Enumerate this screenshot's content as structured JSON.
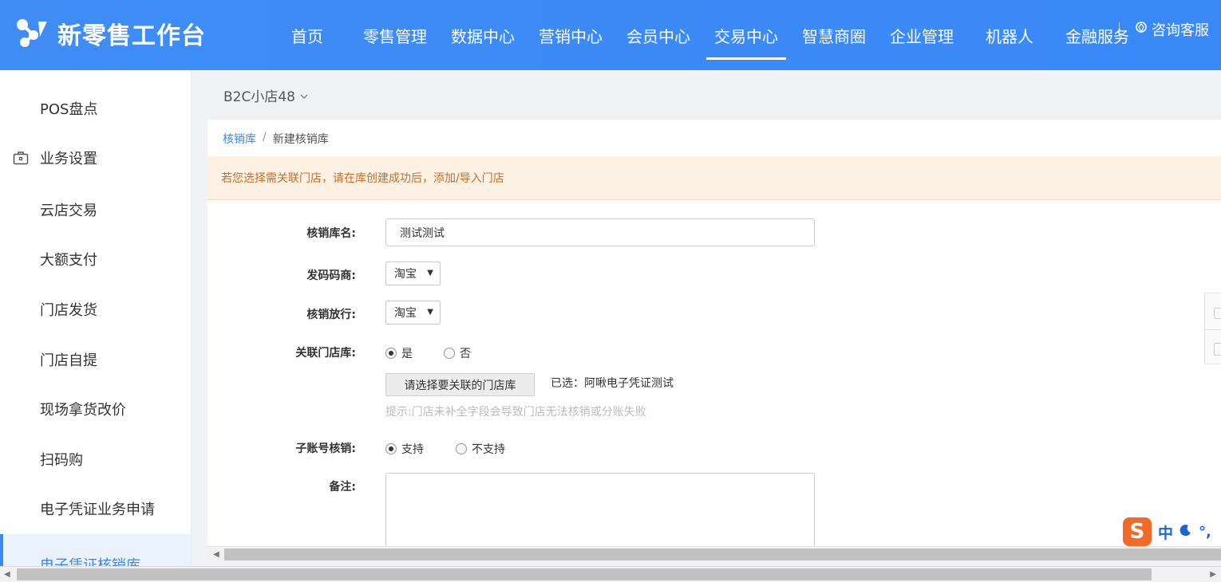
{
  "app": {
    "logo_text": "新零售工作台"
  },
  "nav": {
    "items": [
      "首页",
      "零售管理",
      "数据中心",
      "营销中心",
      "会员中心",
      "交易中心",
      "智慧商圈",
      "企业管理",
      "机器人",
      "金融服务"
    ],
    "active": "交易中心",
    "consult_label": "咨询客服"
  },
  "sidebar": {
    "items": [
      {
        "label": "POS盘点"
      },
      {
        "label": "业务设置",
        "icon": "briefcase-icon"
      },
      {
        "label": "云店交易"
      },
      {
        "label": "大额支付"
      },
      {
        "label": "门店发货"
      },
      {
        "label": "门店自提"
      },
      {
        "label": "现场拿货改价"
      },
      {
        "label": "扫码购"
      },
      {
        "label": "电子凭证业务申请"
      },
      {
        "label": "电子凭证核销库"
      }
    ],
    "active": "电子凭证核销库"
  },
  "store_selector": {
    "value": "B2C小店48"
  },
  "breadcrumb": {
    "parent": "核销库",
    "separator": "/",
    "current": "新建核销库"
  },
  "notice": {
    "text": "若您选择需关联门店，请在库创建成功后，添加/导入门店"
  },
  "form": {
    "name": {
      "label": "核销库名:",
      "value": "测试测试"
    },
    "issuer": {
      "label": "发码码商:",
      "value": "淘宝"
    },
    "release": {
      "label": "核销放行:",
      "value": "淘宝"
    },
    "link_store": {
      "label": "关联门店库:",
      "options": [
        "是",
        "否"
      ],
      "selected": "是",
      "choose_button": "请选择要关联的门店库",
      "selected_text": "已选：阿啾电子凭证测试",
      "hint": "提示:门店未补全字段会导致门店无法核销或分账失败"
    },
    "sub_account": {
      "label": "子账号核销:",
      "options": [
        "支持",
        "不支持"
      ],
      "selected": "支持"
    },
    "remark": {
      "label": "备注:",
      "value": ""
    }
  },
  "ime": {
    "logo": "S",
    "mode": "中",
    "punct": "°,"
  },
  "colors": {
    "header_blue": "#3a89f8",
    "accent": "#3a89f8",
    "notice_bg": "#fdf1e4",
    "notice_text": "#c56f2b",
    "ime_orange": "#f06a2a"
  }
}
